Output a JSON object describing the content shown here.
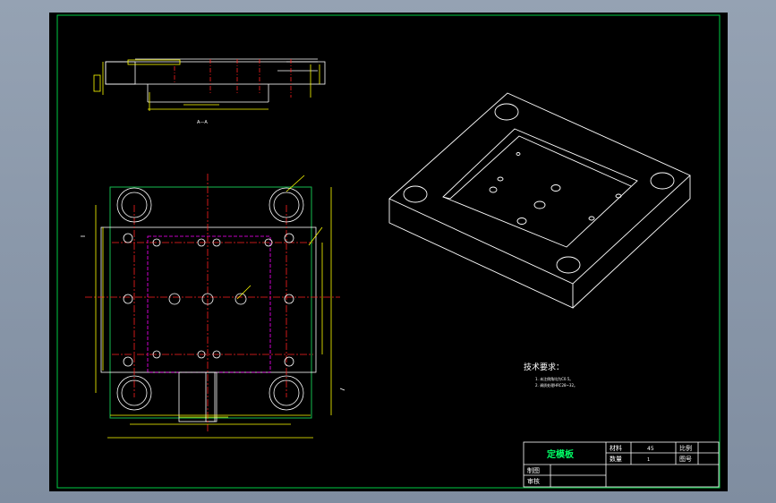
{
  "colors": {
    "background": "#000000",
    "border": "#00cc44",
    "outline": "#ffffff",
    "dimension": "#ffff00",
    "centerline": "#ff2020",
    "hidden": "#ff00ff",
    "grayOuter": "#8a98aa"
  },
  "titleBlock": {
    "partName": "定模板",
    "materialLabel": "材料",
    "materialValue": "45",
    "scaleLabel": "比例",
    "quantityLabel": "数量",
    "quantityValue": "1",
    "drawingNoLabel": "图号",
    "drafterLabel": "制图",
    "checkerLabel": "审核"
  },
  "technicalRequirements": {
    "heading": "技术要求：",
    "items": [
      "1. 未注倒角均为C0.5。",
      "2. 调质处理HRC28~32。"
    ]
  },
  "views": {
    "sectionLabel": "A—A"
  }
}
